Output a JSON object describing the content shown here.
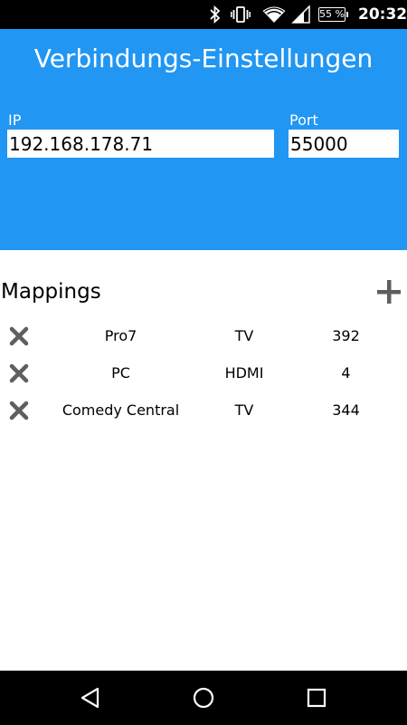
{
  "status_bar": {
    "icons": [
      "bluetooth-icon",
      "vibrate-icon",
      "wifi-icon",
      "cell-signal-icon"
    ],
    "battery": "55 %",
    "time": "20:32"
  },
  "header": {
    "title": "Verbindungs-Einstellungen",
    "ip_label": "IP",
    "ip_value": "192.168.178.71",
    "port_label": "Port",
    "port_value": "55000",
    "color": "#2196f3"
  },
  "mappings": {
    "title": "Mappings",
    "add_icon": "plus-icon",
    "rows": [
      {
        "name": "Pro7",
        "type": "TV",
        "number": "392"
      },
      {
        "name": "PC",
        "type": "HDMI",
        "number": "4"
      },
      {
        "name": "Comedy Central",
        "type": "TV",
        "number": "344"
      }
    ]
  },
  "nav_bar": {
    "buttons": [
      "back-icon",
      "home-icon",
      "recents-icon"
    ]
  }
}
